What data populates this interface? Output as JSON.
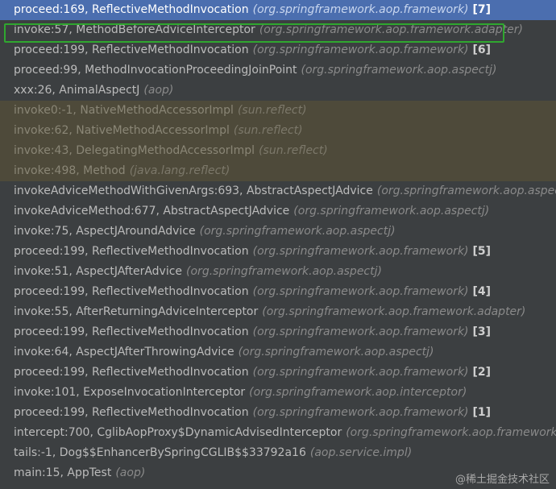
{
  "frames": [
    {
      "method": "proceed:169, ReflectiveMethodInvocation",
      "package": "(org.springframework.aop.framework)",
      "badge": "[7]",
      "state": "selected"
    },
    {
      "method": "invoke:57, MethodBeforeAdviceInterceptor",
      "package": "(org.springframework.aop.framework.adapter)",
      "badge": "",
      "state": "normal"
    },
    {
      "method": "proceed:199, ReflectiveMethodInvocation",
      "package": "(org.springframework.aop.framework)",
      "badge": "[6]",
      "state": "normal"
    },
    {
      "method": "proceed:99, MethodInvocationProceedingJoinPoint",
      "package": "(org.springframework.aop.aspectj)",
      "badge": "",
      "state": "normal"
    },
    {
      "method": "xxx:26, AnimalAspectJ",
      "package": "(aop)",
      "badge": "",
      "state": "normal"
    },
    {
      "method": "invoke0:-1, NativeMethodAccessorImpl",
      "package": "(sun.reflect)",
      "badge": "",
      "state": "library"
    },
    {
      "method": "invoke:62, NativeMethodAccessorImpl",
      "package": "(sun.reflect)",
      "badge": "",
      "state": "library"
    },
    {
      "method": "invoke:43, DelegatingMethodAccessorImpl",
      "package": "(sun.reflect)",
      "badge": "",
      "state": "library"
    },
    {
      "method": "invoke:498, Method",
      "package": "(java.lang.reflect)",
      "badge": "",
      "state": "library"
    },
    {
      "method": "invokeAdviceMethodWithGivenArgs:693, AbstractAspectJAdvice",
      "package": "(org.springframework.aop.aspectj)",
      "badge": "",
      "state": "normal"
    },
    {
      "method": "invokeAdviceMethod:677, AbstractAspectJAdvice",
      "package": "(org.springframework.aop.aspectj)",
      "badge": "",
      "state": "normal"
    },
    {
      "method": "invoke:75, AspectJAroundAdvice",
      "package": "(org.springframework.aop.aspectj)",
      "badge": "",
      "state": "normal"
    },
    {
      "method": "proceed:199, ReflectiveMethodInvocation",
      "package": "(org.springframework.aop.framework)",
      "badge": "[5]",
      "state": "normal"
    },
    {
      "method": "invoke:51, AspectJAfterAdvice",
      "package": "(org.springframework.aop.aspectj)",
      "badge": "",
      "state": "normal"
    },
    {
      "method": "proceed:199, ReflectiveMethodInvocation",
      "package": "(org.springframework.aop.framework)",
      "badge": "[4]",
      "state": "normal"
    },
    {
      "method": "invoke:55, AfterReturningAdviceInterceptor",
      "package": "(org.springframework.aop.framework.adapter)",
      "badge": "",
      "state": "normal"
    },
    {
      "method": "proceed:199, ReflectiveMethodInvocation",
      "package": "(org.springframework.aop.framework)",
      "badge": "[3]",
      "state": "normal"
    },
    {
      "method": "invoke:64, AspectJAfterThrowingAdvice",
      "package": "(org.springframework.aop.aspectj)",
      "badge": "",
      "state": "normal"
    },
    {
      "method": "proceed:199, ReflectiveMethodInvocation",
      "package": "(org.springframework.aop.framework)",
      "badge": "[2]",
      "state": "normal"
    },
    {
      "method": "invoke:101, ExposeInvocationInterceptor",
      "package": "(org.springframework.aop.interceptor)",
      "badge": "",
      "state": "normal"
    },
    {
      "method": "proceed:199, ReflectiveMethodInvocation",
      "package": "(org.springframework.aop.framework)",
      "badge": "[1]",
      "state": "normal"
    },
    {
      "method": "intercept:700, CglibAopProxy$DynamicAdvisedInterceptor",
      "package": "(org.springframework.aop.framework)",
      "badge": "",
      "state": "normal"
    },
    {
      "method": "tails:-1, Dog$$EnhancerBySpringCGLIB$$33792a16",
      "package": "(aop.service.impl)",
      "badge": "",
      "state": "normal"
    },
    {
      "method": "main:15, AppTest",
      "package": "(aop)",
      "badge": "",
      "state": "normal"
    }
  ],
  "highlighted_frame": "invoke:57, MethodBeforeAdviceInterceptor",
  "watermark": "@稀土掘金技术社区",
  "colors": {
    "background": "#3c3f41",
    "selected": "#4b6eaf",
    "library_frame": "#4e4a3a",
    "highlight_border": "#2fa72f"
  }
}
